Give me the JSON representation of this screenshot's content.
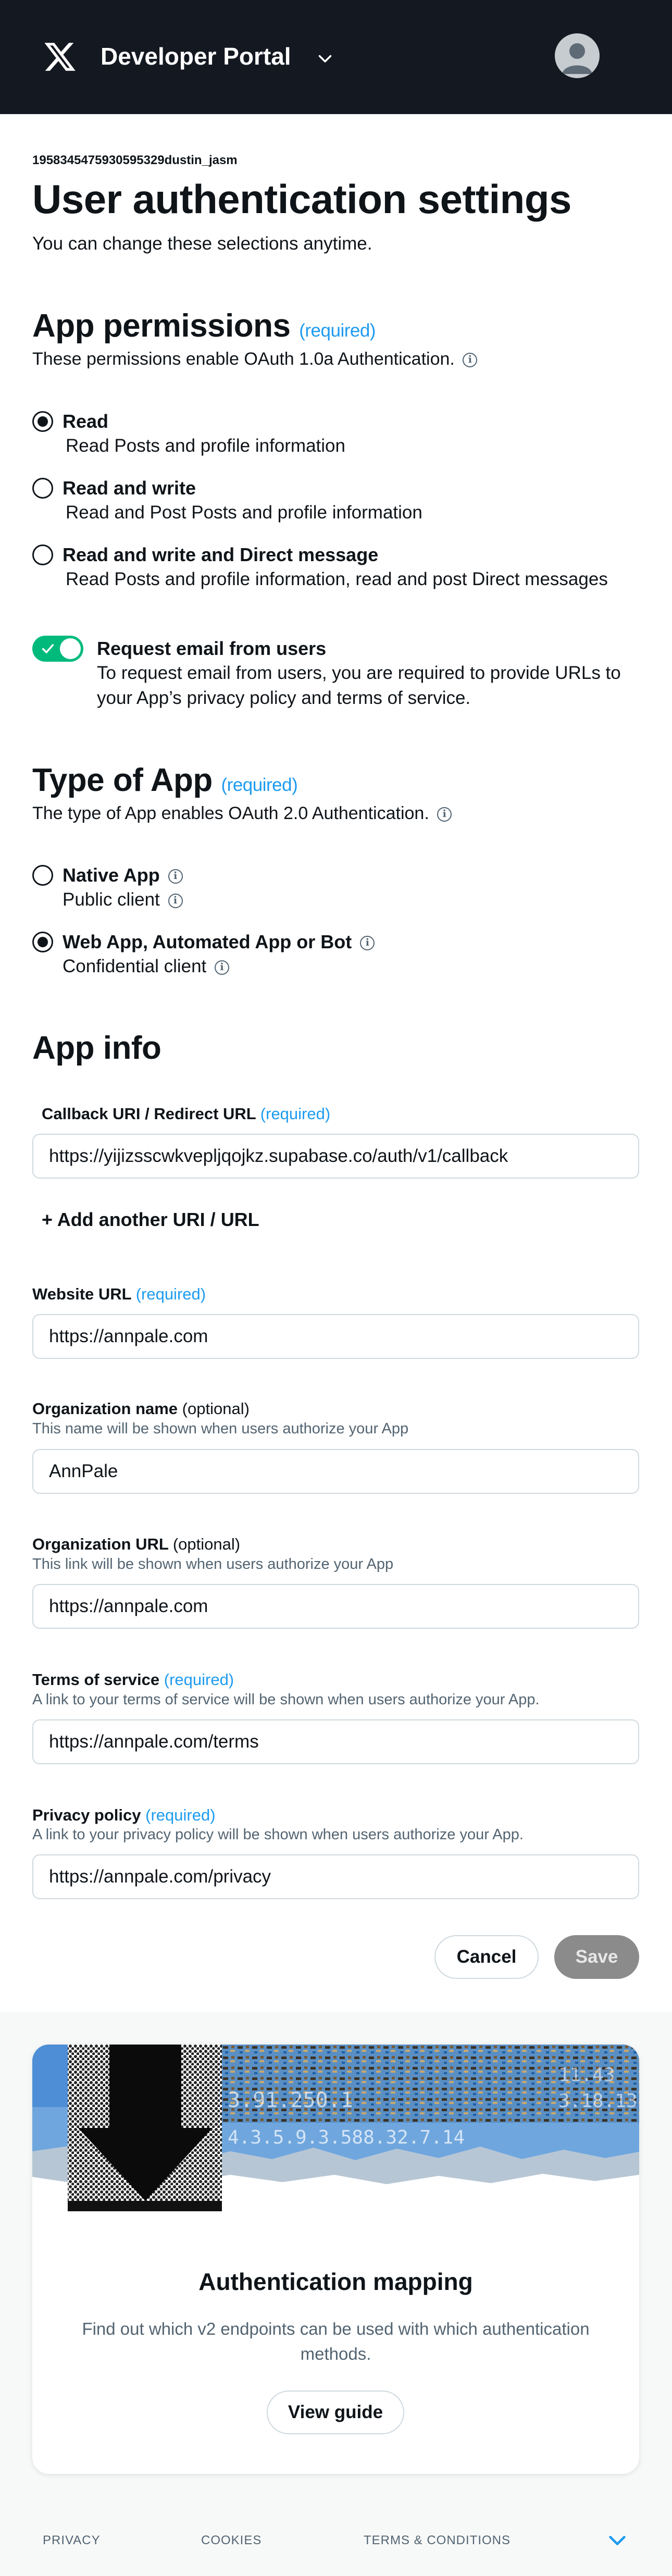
{
  "header": {
    "portal_title": "Developer Portal",
    "logo_icon": "x-logo-icon",
    "menu_icon": "chevron-down-icon",
    "avatar_icon": "user-avatar-icon"
  },
  "app": {
    "id": "1958345475930595329dustin_jasm"
  },
  "page": {
    "title": "User authentication settings",
    "subtitle": "You can change these selections anytime."
  },
  "permissions": {
    "title": "App permissions",
    "required": "(required)",
    "description": "These permissions enable OAuth 1.0a Authentication.",
    "options": [
      {
        "label": "Read",
        "description": "Read Posts and profile information",
        "selected": true
      },
      {
        "label": "Read and write",
        "description": "Read and Post Posts and profile information",
        "selected": false
      },
      {
        "label": "Read and write and Direct message",
        "description": "Read Posts and profile information, read and post Direct messages",
        "selected": false
      }
    ],
    "email_toggle": {
      "label": "Request email from users",
      "description_line1": "To request email from users, you are required to provide URLs to",
      "description_line2": "your App’s privacy policy and terms of service.",
      "enabled": true
    }
  },
  "app_type": {
    "title": "Type of App",
    "required": "(required)",
    "description": "The type of App enables OAuth 2.0 Authentication.",
    "options": [
      {
        "label": "Native App",
        "description": "Public client",
        "selected": false
      },
      {
        "label": "Web App, Automated App or Bot",
        "description": "Confidential client",
        "selected": true
      }
    ]
  },
  "app_info": {
    "title": "App info",
    "callback": {
      "label": "Callback URI / Redirect URL",
      "required": "(required)",
      "value": "https://yijizsscwkvepljqojkz.supabase.co/auth/v1/callback"
    },
    "add_uri": "+ Add another URI / URL",
    "website": {
      "label": "Website URL",
      "required": "(required)",
      "value": "https://annpale.com"
    },
    "org_name": {
      "label": "Organization name",
      "optional": "(optional)",
      "help": "This name will be shown when users authorize your App",
      "value": "AnnPale"
    },
    "org_url": {
      "label": "Organization URL",
      "optional": "(optional)",
      "help": "This link will be shown when users authorize your App",
      "value": "https://annpale.com"
    },
    "terms": {
      "label": "Terms of service",
      "required": "(required)",
      "help": "A link to your terms of service will be shown when users authorize your App.",
      "value": "https://annpale.com/terms"
    },
    "privacy": {
      "label": "Privacy policy",
      "required": "(required)",
      "help": "A link to your privacy policy will be shown when users authorize your App.",
      "value": "https://annpale.com/privacy"
    }
  },
  "actions": {
    "cancel": "Cancel",
    "save": "Save"
  },
  "guide_card": {
    "title": "Authentication mapping",
    "description": "Find out which v2 endpoints can be used with which authentication methods.",
    "button": "View guide",
    "art_numbers_1": "3.91.250.1",
    "art_numbers_2": "4.3.5.9.3.588.32.7.14",
    "art_numbers_3": "3.18.13",
    "art_numbers_4": "11.43"
  },
  "footer": {
    "privacy": "PRIVACY",
    "cookies": "COOKIES",
    "terms": "TERMS & CONDITIONS"
  },
  "colors": {
    "header_bg": "#141820",
    "accent_blue": "#1d9bf0",
    "toggle_green": "#00ba7c",
    "save_disabled": "#8b8b8b"
  }
}
